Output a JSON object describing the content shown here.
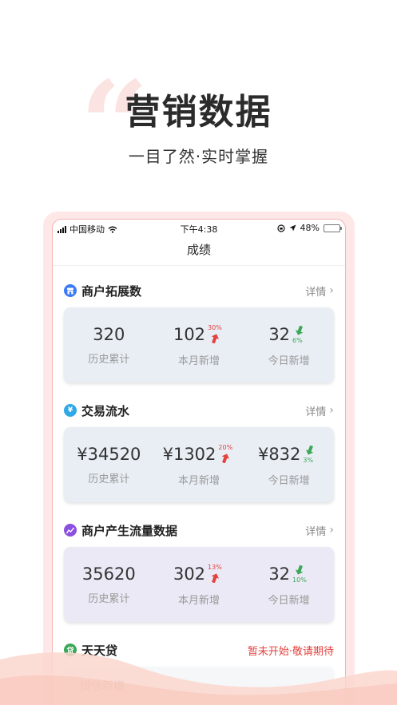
{
  "hero": {
    "quote_glyph": "“",
    "title": "营销数据",
    "subtitle": "一目了然·实时掌握"
  },
  "status_bar": {
    "carrier": "中国移动",
    "time": "下午4:38",
    "battery": "48%",
    "battery_level": 0.48
  },
  "nav": {
    "title": "成绩"
  },
  "sections": {
    "merchants": {
      "title": "商户拓展数",
      "icon": "shop-icon",
      "icon_color": "#3d7bf5",
      "card_bg": "#e9eef5",
      "link": "详情",
      "total": {
        "value": "320",
        "label": "历史累计"
      },
      "month": {
        "value": "102",
        "label": "本月新增",
        "pct": "30%"
      },
      "today": {
        "value": "32",
        "label": "今日新增",
        "pct": "6%"
      }
    },
    "flow": {
      "title": "交易流水",
      "icon": "yen-icon",
      "icon_color": "#2fa8e8",
      "card_bg": "#e9eef5",
      "link": "详情",
      "total": {
        "value": "¥34520",
        "label": "历史累计"
      },
      "month": {
        "value": "¥1302",
        "label": "本月新增",
        "pct": "20%"
      },
      "today": {
        "value": "¥832",
        "label": "今日新增",
        "pct": "3%"
      }
    },
    "traffic": {
      "title": "商户产生流量数据",
      "icon": "chart-icon",
      "icon_color": "#8c4fe0",
      "card_bg": "#ebe9f5",
      "link": "详情",
      "total": {
        "value": "35620",
        "label": "历史累计"
      },
      "month": {
        "value": "302",
        "label": "本月新增",
        "pct": "13%"
      },
      "today": {
        "value": "32",
        "label": "今日新增",
        "pct": "10%"
      }
    },
    "loan": {
      "title": "天天贷",
      "icon": "loan-icon",
      "icon_glyph": "贷",
      "icon_color": "#3aa857",
      "status": "暂未开始·敬请期待",
      "partial_label": "授信新增"
    }
  },
  "colors": {
    "up": "#e3423f",
    "down": "#3aa857",
    "accent_bg": "#fde8e7"
  }
}
